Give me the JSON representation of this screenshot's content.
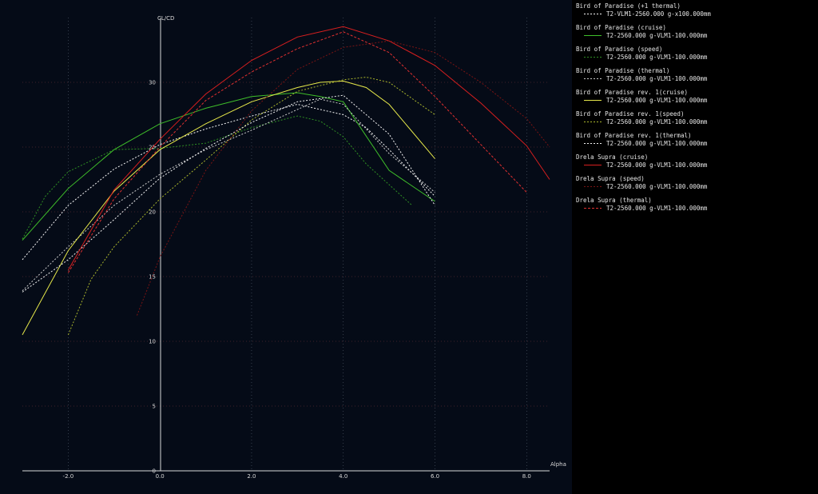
{
  "chart_data": {
    "type": "line",
    "xlabel": "Alpha",
    "ylabel": "CL/CD",
    "xlim": [
      -3.0,
      8.5
    ],
    "ylim": [
      0,
      35
    ],
    "x_ticks": [
      "-2.0",
      "0.0",
      "2.0",
      "4.0",
      "6.0",
      "8.0"
    ],
    "y_ticks": [
      "0",
      "5",
      "10",
      "15",
      "20",
      "25",
      "30"
    ],
    "grid": true,
    "legend_position": "right",
    "series": [
      {
        "name": "Bird of Paradise (+1 thermal)",
        "description": "T2-VLM1-2560.000 g-x100.000mm",
        "color": "#f4f4f4",
        "dash": "2,2",
        "x": [
          -3,
          -2,
          -1,
          0,
          1,
          2,
          3,
          4,
          4.5,
          5,
          6
        ],
        "y": [
          16.3,
          20.5,
          23.3,
          25.2,
          26.4,
          27.4,
          28.3,
          27.5,
          26.5,
          24.8,
          21.2
        ]
      },
      {
        "name": "Bird of Paradise (cruise)",
        "description": "T2-2560.000 g-VLM1-100.000mm",
        "color": "#3fbf2a",
        "dash": "",
        "x": [
          -3,
          -2,
          -1,
          0,
          1,
          2,
          3,
          3.5,
          4,
          5,
          6
        ],
        "y": [
          17.8,
          21.8,
          24.8,
          26.8,
          28.0,
          28.9,
          29.2,
          28.9,
          28.5,
          23.2,
          20.8
        ]
      },
      {
        "name": "Bird of Paradise (speed)",
        "description": "T2-2560.000 g-VLM1-100.000mm",
        "color": "#2f8f23",
        "dash": "2,2",
        "x": [
          -3,
          -2.5,
          -2,
          -1,
          0,
          1,
          2,
          3,
          3.5,
          4,
          4.5,
          5,
          5.5
        ],
        "y": [
          17.9,
          21.2,
          23.1,
          24.8,
          24.9,
          25.3,
          26.5,
          27.4,
          27.0,
          25.8,
          23.7,
          22.1,
          20.5
        ]
      },
      {
        "name": "Bird of Paradise (thermal)",
        "description": "T2-2560.000 g-VLM1-100.000mm",
        "color": "#c9c9c9",
        "dash": "2,2",
        "x": [
          -3,
          -2,
          -1,
          0,
          1,
          2,
          3,
          3.5,
          4,
          5,
          6
        ],
        "y": [
          13.9,
          17.3,
          20.5,
          22.9,
          24.8,
          26.3,
          27.9,
          28.7,
          28.3,
          24.5,
          21.5
        ]
      },
      {
        "name": "Bird of Paradise rev. 1(cruise)",
        "description": "T2-2560.000 g-VLM1-100.000mm",
        "color": "#e6e84a",
        "dash": "",
        "x": [
          -3,
          -2,
          -1,
          0,
          1,
          2,
          3,
          3.5,
          4,
          4.5,
          5,
          6
        ],
        "y": [
          10.5,
          17.0,
          21.6,
          24.8,
          26.8,
          28.5,
          29.6,
          30.0,
          30.1,
          29.6,
          28.3,
          24.1
        ]
      },
      {
        "name": "Bird of Paradise rev. 1(speed)",
        "description": "T2-2560.000 g-VLM1-100.000mm",
        "color": "#a9b52c",
        "dash": "2,2",
        "x": [
          -2,
          -1.5,
          -1,
          0,
          1,
          2,
          3,
          4,
          4.5,
          5,
          6
        ],
        "y": [
          10.5,
          14.8,
          17.3,
          21.0,
          24.0,
          27.1,
          29.3,
          30.2,
          30.4,
          30.0,
          27.5
        ]
      },
      {
        "name": "Bird of Paradise rev. 1(thermal)",
        "description": "T2-2560.000 g-VLM1-100.000mm",
        "color": "#f2f2f2",
        "dash": "2,2",
        "x": [
          -3,
          -2,
          -1,
          0,
          1,
          2,
          3,
          4,
          5,
          6
        ],
        "y": [
          13.8,
          16.3,
          19.4,
          22.6,
          24.9,
          26.9,
          28.5,
          29.0,
          26.0,
          20.5
        ]
      },
      {
        "name": "Drela Supra (cruise)",
        "description": "T2-2560.000 g-VLM1-100.000mm",
        "color": "#d81f1f",
        "dash": "",
        "x": [
          -2,
          -1,
          0,
          1,
          2,
          3,
          4,
          5,
          6,
          7,
          8,
          8.5
        ],
        "y": [
          15.5,
          21.7,
          25.6,
          29.1,
          31.7,
          33.5,
          34.3,
          33.2,
          31.3,
          28.4,
          25.1,
          22.5
        ]
      },
      {
        "name": "Drela Supra (speed)",
        "description": "T2-2560.000 g-VLM1-100.000mm",
        "color": "#7a1414",
        "dash": "2,2",
        "x": [
          -0.5,
          0,
          1,
          2,
          3,
          4,
          5,
          6,
          7,
          8,
          8.5
        ],
        "y": [
          12.0,
          16.5,
          23.2,
          27.8,
          31.0,
          32.7,
          33.2,
          32.3,
          30.0,
          27.2,
          25.0
        ]
      },
      {
        "name": "Drela Supra (thermal)",
        "description": "T2-2560.000 g-VLM1-100.000mm",
        "color": "#e03030",
        "dash": "3,2",
        "x": [
          -2,
          -1,
          0,
          1,
          2,
          3,
          4,
          5,
          6,
          7,
          8
        ],
        "y": [
          15.3,
          21.0,
          25.0,
          28.6,
          30.8,
          32.6,
          33.9,
          32.3,
          28.9,
          25.2,
          21.5
        ]
      }
    ]
  }
}
